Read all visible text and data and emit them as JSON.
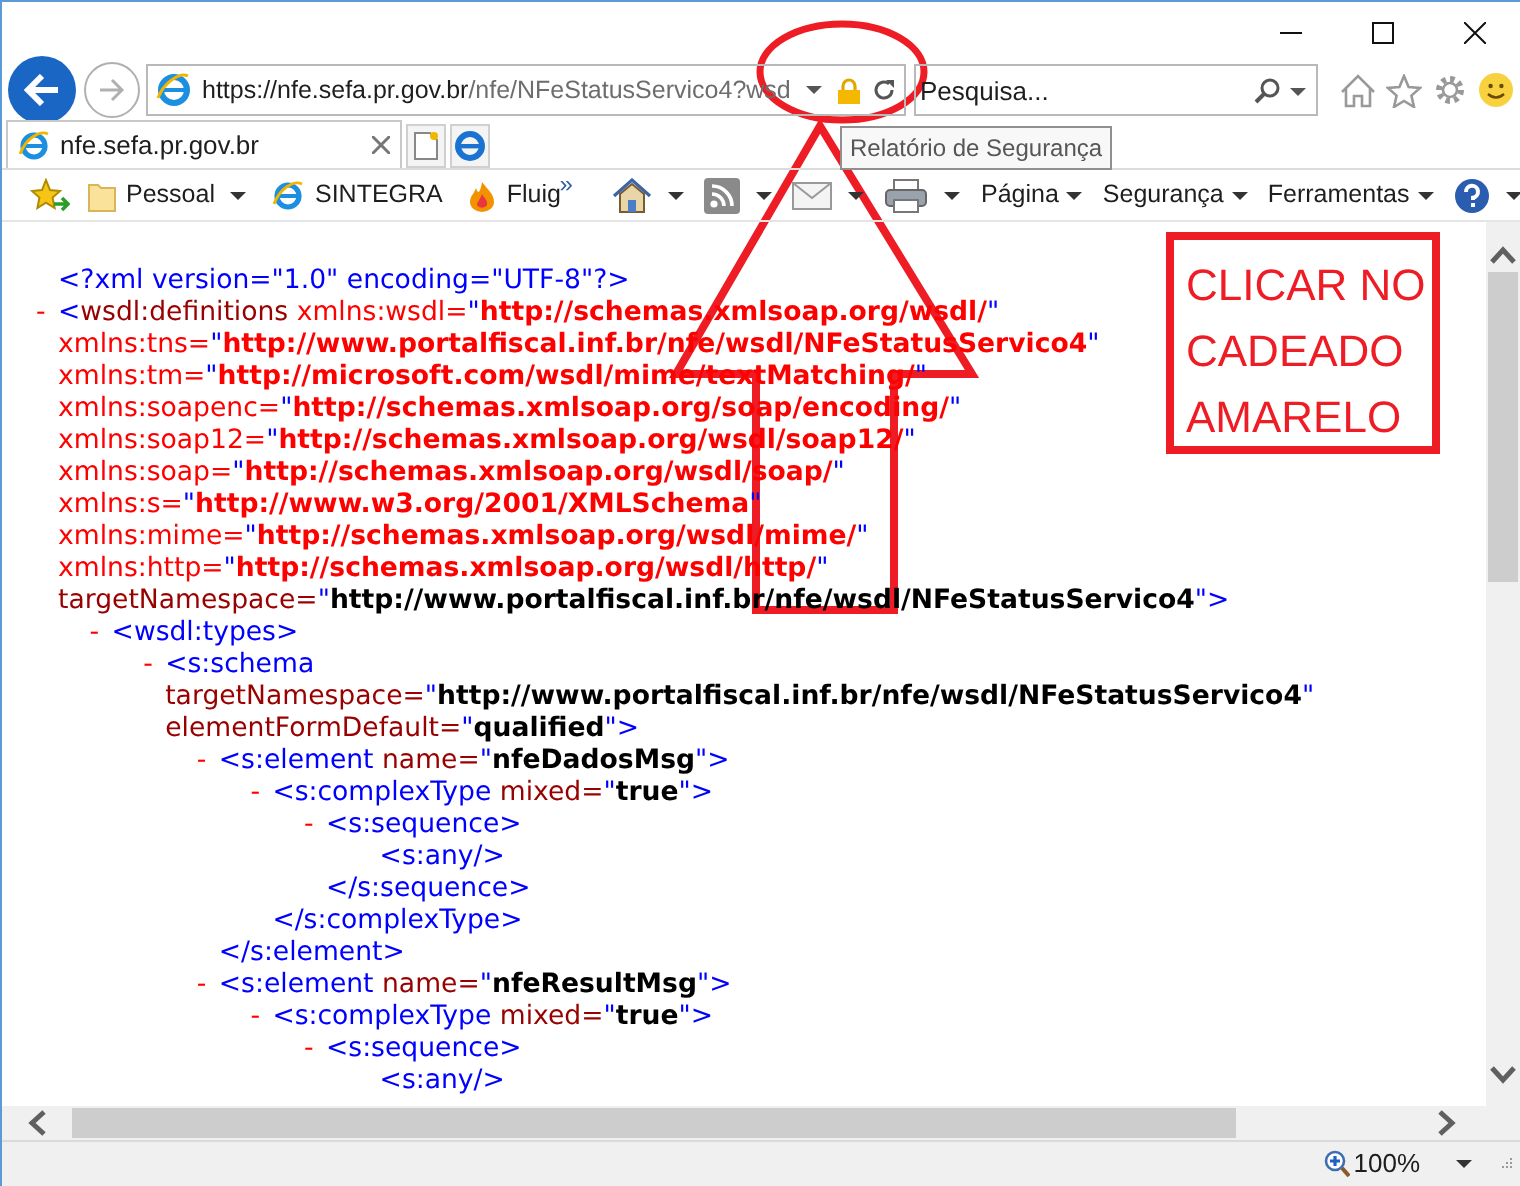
{
  "browser": {
    "address": {
      "host": "https://nfe.sefa.pr.gov.br",
      "path": "/nfe/NFeStatusServico4?wsd"
    },
    "search": {
      "placeholder": "Pesquisa..."
    },
    "tabs": [
      {
        "label": "nfe.sefa.pr.gov.br",
        "selected": true
      }
    ],
    "tooltip": "Relatório de Segurança",
    "favorites": [
      {
        "kind": "folder",
        "label": "Pessoal"
      },
      {
        "kind": "page",
        "label": "SINTEGRA"
      },
      {
        "kind": "flame",
        "label": "Fluig"
      }
    ],
    "favorites_overflow": "»",
    "command_bar": [
      {
        "kind": "home"
      },
      {
        "kind": "feeds"
      },
      {
        "kind": "mail"
      },
      {
        "kind": "print"
      },
      {
        "kind": "menu",
        "label": "Página"
      },
      {
        "kind": "menu",
        "label": "Segurança"
      },
      {
        "kind": "menu",
        "label": "Ferramentas"
      },
      {
        "kind": "help"
      }
    ],
    "zoom": "100%"
  },
  "xml": [
    {
      "lines": [
        [
          {
            "kind": "markup",
            "text": "<?xml version=\"1.0\" encoding=\"UTF-8\"?>"
          }
        ]
      ]
    },
    {
      "toggle": "-",
      "lines": [
        [
          {
            "kind": "markup",
            "text": "<"
          },
          {
            "kind": "tag",
            "text": "wsdl:definitions"
          },
          {
            "kind": "ns_attr",
            "text": " xmlns:wsdl="
          },
          {
            "kind": "markup",
            "text": "\""
          },
          {
            "kind": "ns_value",
            "text": "http://schemas.xmlsoap.org/wsdl/"
          },
          {
            "kind": "markup",
            "text": "\""
          }
        ],
        [
          {
            "kind": "ns_attr",
            "text": "xmlns:tns="
          },
          {
            "kind": "markup",
            "text": "\""
          },
          {
            "kind": "ns_value",
            "text": "http://www.portalfiscal.inf.br/nfe/wsdl/NFeStatusServico4"
          },
          {
            "kind": "markup",
            "text": "\""
          }
        ],
        [
          {
            "kind": "ns_attr",
            "text": "xmlns:tm="
          },
          {
            "kind": "markup",
            "text": "\""
          },
          {
            "kind": "ns_value",
            "text": "http://microsoft.com/wsdl/mime/textMatching/"
          },
          {
            "kind": "markup",
            "text": "\""
          }
        ],
        [
          {
            "kind": "ns_attr",
            "text": "xmlns:soapenc="
          },
          {
            "kind": "markup",
            "text": "\""
          },
          {
            "kind": "ns_value",
            "text": "http://schemas.xmlsoap.org/soap/encoding/"
          },
          {
            "kind": "markup",
            "text": "\""
          }
        ],
        [
          {
            "kind": "ns_attr",
            "text": "xmlns:soap12="
          },
          {
            "kind": "markup",
            "text": "\""
          },
          {
            "kind": "ns_value",
            "text": "http://schemas.xmlsoap.org/wsdl/soap12/"
          },
          {
            "kind": "markup",
            "text": "\""
          }
        ],
        [
          {
            "kind": "ns_attr",
            "text": "xmlns:soap="
          },
          {
            "kind": "markup",
            "text": "\""
          },
          {
            "kind": "ns_value",
            "text": "http://schemas.xmlsoap.org/wsdl/soap/"
          },
          {
            "kind": "markup",
            "text": "\""
          }
        ],
        [
          {
            "kind": "ns_attr",
            "text": "xmlns:s="
          },
          {
            "kind": "markup",
            "text": "\""
          },
          {
            "kind": "ns_value",
            "text": "http://www.w3.org/2001/XMLSchema"
          },
          {
            "kind": "markup",
            "text": "\""
          }
        ],
        [
          {
            "kind": "ns_attr",
            "text": "xmlns:mime="
          },
          {
            "kind": "markup",
            "text": "\""
          },
          {
            "kind": "ns_value",
            "text": "http://schemas.xmlsoap.org/wsdl/mime/"
          },
          {
            "kind": "markup",
            "text": "\""
          }
        ],
        [
          {
            "kind": "ns_attr",
            "text": "xmlns:http="
          },
          {
            "kind": "markup",
            "text": "\""
          },
          {
            "kind": "ns_value",
            "text": "http://schemas.xmlsoap.org/wsdl/http/"
          },
          {
            "kind": "markup",
            "text": "\""
          }
        ],
        [
          {
            "kind": "attr",
            "text": "targetNamespace="
          },
          {
            "kind": "markup",
            "text": "\""
          },
          {
            "kind": "value",
            "text": "http://www.portalfiscal.inf.br/nfe/wsdl/NFeStatusServico4"
          },
          {
            "kind": "markup",
            "text": "\">"
          }
        ]
      ],
      "children": [
        {
          "toggle": "-",
          "lines": [
            [
              {
                "kind": "markup",
                "text": "<wsdl:types>"
              }
            ]
          ],
          "children": [
            {
              "toggle": "-",
              "lines": [
                [
                  {
                    "kind": "markup",
                    "text": "<s:schema"
                  }
                ],
                [
                  {
                    "kind": "attr",
                    "text": "targetNamespace="
                  },
                  {
                    "kind": "markup",
                    "text": "\""
                  },
                  {
                    "kind": "value",
                    "text": "http://www.portalfiscal.inf.br/nfe/wsdl/NFeStatusServico4"
                  },
                  {
                    "kind": "markup",
                    "text": "\""
                  }
                ],
                [
                  {
                    "kind": "attr",
                    "text": "elementFormDefault="
                  },
                  {
                    "kind": "markup",
                    "text": "\""
                  },
                  {
                    "kind": "value",
                    "text": "qualified"
                  },
                  {
                    "kind": "markup",
                    "text": "\">"
                  }
                ]
              ],
              "children": [
                {
                  "toggle": "-",
                  "lines": [
                    [
                      {
                        "kind": "markup",
                        "text": "<s:element"
                      },
                      {
                        "kind": "attr",
                        "text": " name="
                      },
                      {
                        "kind": "markup",
                        "text": "\""
                      },
                      {
                        "kind": "value",
                        "text": "nfeDadosMsg"
                      },
                      {
                        "kind": "markup",
                        "text": "\">"
                      }
                    ]
                  ],
                  "children": [
                    {
                      "toggle": "-",
                      "lines": [
                        [
                          {
                            "kind": "markup",
                            "text": "<s:complexType"
                          },
                          {
                            "kind": "attr",
                            "text": " mixed="
                          },
                          {
                            "kind": "markup",
                            "text": "\""
                          },
                          {
                            "kind": "value",
                            "text": "true"
                          },
                          {
                            "kind": "markup",
                            "text": "\">"
                          }
                        ]
                      ],
                      "children": [
                        {
                          "toggle": "-",
                          "lines": [
                            [
                              {
                                "kind": "markup",
                                "text": "<s:sequence>"
                              }
                            ]
                          ],
                          "children": [
                            {
                              "lines": [
                                [
                                  {
                                    "kind": "markup",
                                    "text": "<s:any/>"
                                  }
                                ]
                              ]
                            }
                          ]
                        },
                        {
                          "lines": [
                            [
                              {
                                "kind": "markup",
                                "text": "</s:sequence>"
                              }
                            ]
                          ]
                        }
                      ]
                    },
                    {
                      "lines": [
                        [
                          {
                            "kind": "markup",
                            "text": "</s:complexType>"
                          }
                        ]
                      ]
                    }
                  ]
                },
                {
                  "lines": [
                    [
                      {
                        "kind": "markup",
                        "text": "</s:element>"
                      }
                    ]
                  ]
                },
                {
                  "toggle": "-",
                  "lines": [
                    [
                      {
                        "kind": "markup",
                        "text": "<s:element"
                      },
                      {
                        "kind": "attr",
                        "text": " name="
                      },
                      {
                        "kind": "markup",
                        "text": "\""
                      },
                      {
                        "kind": "value",
                        "text": "nfeResultMsg"
                      },
                      {
                        "kind": "markup",
                        "text": "\">"
                      }
                    ]
                  ],
                  "children": [
                    {
                      "toggle": "-",
                      "lines": [
                        [
                          {
                            "kind": "markup",
                            "text": "<s:complexType"
                          },
                          {
                            "kind": "attr",
                            "text": " mixed="
                          },
                          {
                            "kind": "markup",
                            "text": "\""
                          },
                          {
                            "kind": "value",
                            "text": "true"
                          },
                          {
                            "kind": "markup",
                            "text": "\">"
                          }
                        ]
                      ],
                      "children": [
                        {
                          "toggle": "-",
                          "lines": [
                            [
                              {
                                "kind": "markup",
                                "text": "<s:sequence>"
                              }
                            ]
                          ],
                          "children": [
                            {
                              "lines": [
                                [
                                  {
                                    "kind": "markup",
                                    "text": "<s:any/>"
                                  }
                                ]
                              ]
                            }
                          ]
                        }
                      ]
                    }
                  ]
                }
              ]
            }
          ]
        }
      ]
    }
  ],
  "annotation": {
    "note": "CLICAR NO CADEADO AMARELO"
  }
}
